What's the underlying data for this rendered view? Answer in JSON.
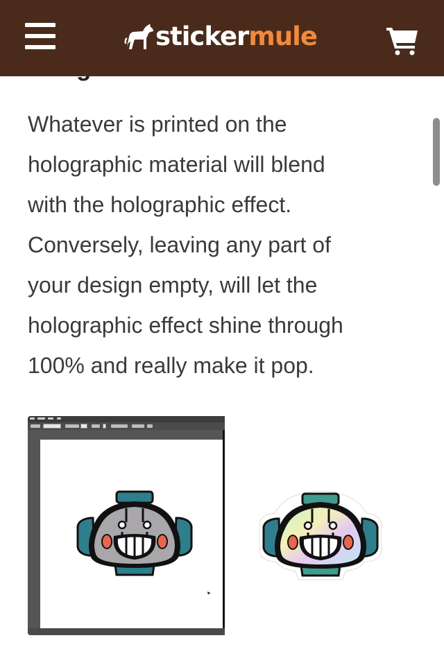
{
  "header": {
    "logo_text_white": "sticker",
    "logo_text_orange": "mule",
    "background_color": "#4a2b1b",
    "accent_color": "#f0893c",
    "menu_icon": "hamburger-menu-icon",
    "logo_icon": "mule-logo-icon",
    "cart_icon": "shopping-cart-icon"
  },
  "article": {
    "partial_heading": "design",
    "paragraph_lines": [
      "Whatever is printed on the",
      "holographic material will blend",
      "with the holographic effect.",
      "Conversely, leaving any part of",
      "your design empty, will let the",
      "holographic effect shine through",
      "100% and really make it pop."
    ]
  },
  "images": {
    "left": "design-editor-screenshot-robot",
    "right": "holographic-robot-sticker"
  }
}
